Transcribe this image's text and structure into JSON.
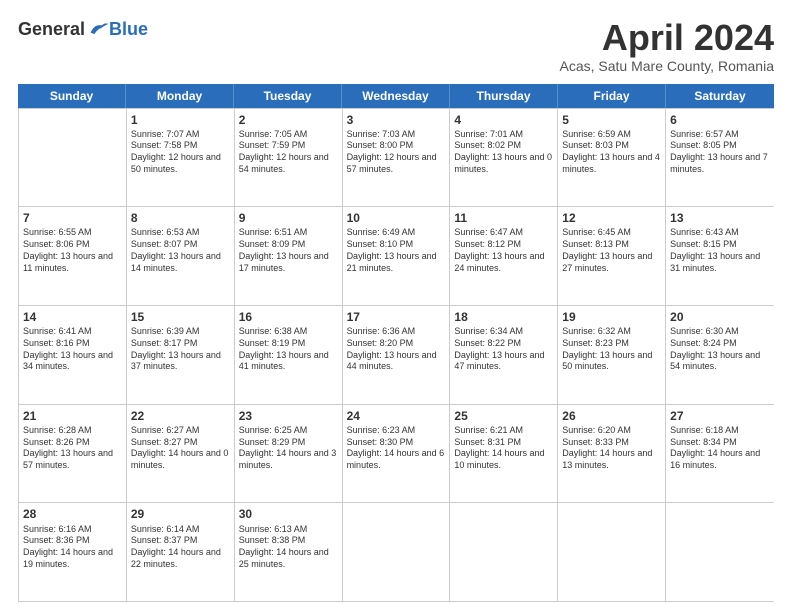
{
  "header": {
    "logo_general": "General",
    "logo_blue": "Blue",
    "month_title": "April 2024",
    "location": "Acas, Satu Mare County, Romania"
  },
  "weekdays": [
    "Sunday",
    "Monday",
    "Tuesday",
    "Wednesday",
    "Thursday",
    "Friday",
    "Saturday"
  ],
  "weeks": [
    [
      {
        "day": "",
        "sunrise": "",
        "sunset": "",
        "daylight": ""
      },
      {
        "day": "1",
        "sunrise": "Sunrise: 7:07 AM",
        "sunset": "Sunset: 7:58 PM",
        "daylight": "Daylight: 12 hours and 50 minutes."
      },
      {
        "day": "2",
        "sunrise": "Sunrise: 7:05 AM",
        "sunset": "Sunset: 7:59 PM",
        "daylight": "Daylight: 12 hours and 54 minutes."
      },
      {
        "day": "3",
        "sunrise": "Sunrise: 7:03 AM",
        "sunset": "Sunset: 8:00 PM",
        "daylight": "Daylight: 12 hours and 57 minutes."
      },
      {
        "day": "4",
        "sunrise": "Sunrise: 7:01 AM",
        "sunset": "Sunset: 8:02 PM",
        "daylight": "Daylight: 13 hours and 0 minutes."
      },
      {
        "day": "5",
        "sunrise": "Sunrise: 6:59 AM",
        "sunset": "Sunset: 8:03 PM",
        "daylight": "Daylight: 13 hours and 4 minutes."
      },
      {
        "day": "6",
        "sunrise": "Sunrise: 6:57 AM",
        "sunset": "Sunset: 8:05 PM",
        "daylight": "Daylight: 13 hours and 7 minutes."
      }
    ],
    [
      {
        "day": "7",
        "sunrise": "Sunrise: 6:55 AM",
        "sunset": "Sunset: 8:06 PM",
        "daylight": "Daylight: 13 hours and 11 minutes."
      },
      {
        "day": "8",
        "sunrise": "Sunrise: 6:53 AM",
        "sunset": "Sunset: 8:07 PM",
        "daylight": "Daylight: 13 hours and 14 minutes."
      },
      {
        "day": "9",
        "sunrise": "Sunrise: 6:51 AM",
        "sunset": "Sunset: 8:09 PM",
        "daylight": "Daylight: 13 hours and 17 minutes."
      },
      {
        "day": "10",
        "sunrise": "Sunrise: 6:49 AM",
        "sunset": "Sunset: 8:10 PM",
        "daylight": "Daylight: 13 hours and 21 minutes."
      },
      {
        "day": "11",
        "sunrise": "Sunrise: 6:47 AM",
        "sunset": "Sunset: 8:12 PM",
        "daylight": "Daylight: 13 hours and 24 minutes."
      },
      {
        "day": "12",
        "sunrise": "Sunrise: 6:45 AM",
        "sunset": "Sunset: 8:13 PM",
        "daylight": "Daylight: 13 hours and 27 minutes."
      },
      {
        "day": "13",
        "sunrise": "Sunrise: 6:43 AM",
        "sunset": "Sunset: 8:15 PM",
        "daylight": "Daylight: 13 hours and 31 minutes."
      }
    ],
    [
      {
        "day": "14",
        "sunrise": "Sunrise: 6:41 AM",
        "sunset": "Sunset: 8:16 PM",
        "daylight": "Daylight: 13 hours and 34 minutes."
      },
      {
        "day": "15",
        "sunrise": "Sunrise: 6:39 AM",
        "sunset": "Sunset: 8:17 PM",
        "daylight": "Daylight: 13 hours and 37 minutes."
      },
      {
        "day": "16",
        "sunrise": "Sunrise: 6:38 AM",
        "sunset": "Sunset: 8:19 PM",
        "daylight": "Daylight: 13 hours and 41 minutes."
      },
      {
        "day": "17",
        "sunrise": "Sunrise: 6:36 AM",
        "sunset": "Sunset: 8:20 PM",
        "daylight": "Daylight: 13 hours and 44 minutes."
      },
      {
        "day": "18",
        "sunrise": "Sunrise: 6:34 AM",
        "sunset": "Sunset: 8:22 PM",
        "daylight": "Daylight: 13 hours and 47 minutes."
      },
      {
        "day": "19",
        "sunrise": "Sunrise: 6:32 AM",
        "sunset": "Sunset: 8:23 PM",
        "daylight": "Daylight: 13 hours and 50 minutes."
      },
      {
        "day": "20",
        "sunrise": "Sunrise: 6:30 AM",
        "sunset": "Sunset: 8:24 PM",
        "daylight": "Daylight: 13 hours and 54 minutes."
      }
    ],
    [
      {
        "day": "21",
        "sunrise": "Sunrise: 6:28 AM",
        "sunset": "Sunset: 8:26 PM",
        "daylight": "Daylight: 13 hours and 57 minutes."
      },
      {
        "day": "22",
        "sunrise": "Sunrise: 6:27 AM",
        "sunset": "Sunset: 8:27 PM",
        "daylight": "Daylight: 14 hours and 0 minutes."
      },
      {
        "day": "23",
        "sunrise": "Sunrise: 6:25 AM",
        "sunset": "Sunset: 8:29 PM",
        "daylight": "Daylight: 14 hours and 3 minutes."
      },
      {
        "day": "24",
        "sunrise": "Sunrise: 6:23 AM",
        "sunset": "Sunset: 8:30 PM",
        "daylight": "Daylight: 14 hours and 6 minutes."
      },
      {
        "day": "25",
        "sunrise": "Sunrise: 6:21 AM",
        "sunset": "Sunset: 8:31 PM",
        "daylight": "Daylight: 14 hours and 10 minutes."
      },
      {
        "day": "26",
        "sunrise": "Sunrise: 6:20 AM",
        "sunset": "Sunset: 8:33 PM",
        "daylight": "Daylight: 14 hours and 13 minutes."
      },
      {
        "day": "27",
        "sunrise": "Sunrise: 6:18 AM",
        "sunset": "Sunset: 8:34 PM",
        "daylight": "Daylight: 14 hours and 16 minutes."
      }
    ],
    [
      {
        "day": "28",
        "sunrise": "Sunrise: 6:16 AM",
        "sunset": "Sunset: 8:36 PM",
        "daylight": "Daylight: 14 hours and 19 minutes."
      },
      {
        "day": "29",
        "sunrise": "Sunrise: 6:14 AM",
        "sunset": "Sunset: 8:37 PM",
        "daylight": "Daylight: 14 hours and 22 minutes."
      },
      {
        "day": "30",
        "sunrise": "Sunrise: 6:13 AM",
        "sunset": "Sunset: 8:38 PM",
        "daylight": "Daylight: 14 hours and 25 minutes."
      },
      {
        "day": "",
        "sunrise": "",
        "sunset": "",
        "daylight": ""
      },
      {
        "day": "",
        "sunrise": "",
        "sunset": "",
        "daylight": ""
      },
      {
        "day": "",
        "sunrise": "",
        "sunset": "",
        "daylight": ""
      },
      {
        "day": "",
        "sunrise": "",
        "sunset": "",
        "daylight": ""
      }
    ]
  ]
}
